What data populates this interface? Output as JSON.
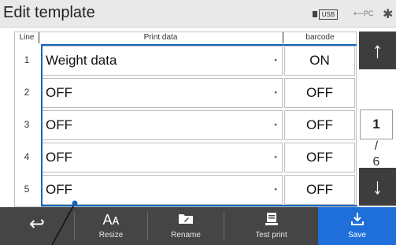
{
  "header": {
    "title": "Edit template",
    "usb_label": "USB",
    "pc_label": "PC",
    "bluetooth_glyph": "✱"
  },
  "table": {
    "columns": {
      "line": "Line",
      "print_data": "Print data",
      "barcode": "barcode"
    },
    "rows": [
      {
        "line": "1",
        "print_data": "Weight data",
        "barcode": "ON"
      },
      {
        "line": "2",
        "print_data": "OFF",
        "barcode": "OFF"
      },
      {
        "line": "3",
        "print_data": "OFF",
        "barcode": "OFF"
      },
      {
        "line": "4",
        "print_data": "OFF",
        "barcode": "OFF"
      },
      {
        "line": "5",
        "print_data": "OFF",
        "barcode": "OFF"
      }
    ]
  },
  "pager": {
    "current": "1",
    "separator": "/",
    "total": "6",
    "up_glyph": "↑",
    "down_glyph": "↓"
  },
  "toolbar": {
    "back_glyph": "↩",
    "resize_label": "Resize",
    "resize_glyph": "Aᴀ",
    "rename_label": "Rename",
    "test_print_label": "Test print",
    "save_label": "Save"
  },
  "icons": [
    "usb-icon",
    "pc-icon",
    "bluetooth-icon",
    "arrow-up-icon",
    "arrow-down-icon",
    "back-icon",
    "resize-icon",
    "folder-icon",
    "print-icon",
    "save-icon"
  ],
  "colors": {
    "accent": "#1e6fd9",
    "selection": "#1565c0",
    "toolbar": "#454545",
    "nav_button": "#3d3d3d"
  }
}
